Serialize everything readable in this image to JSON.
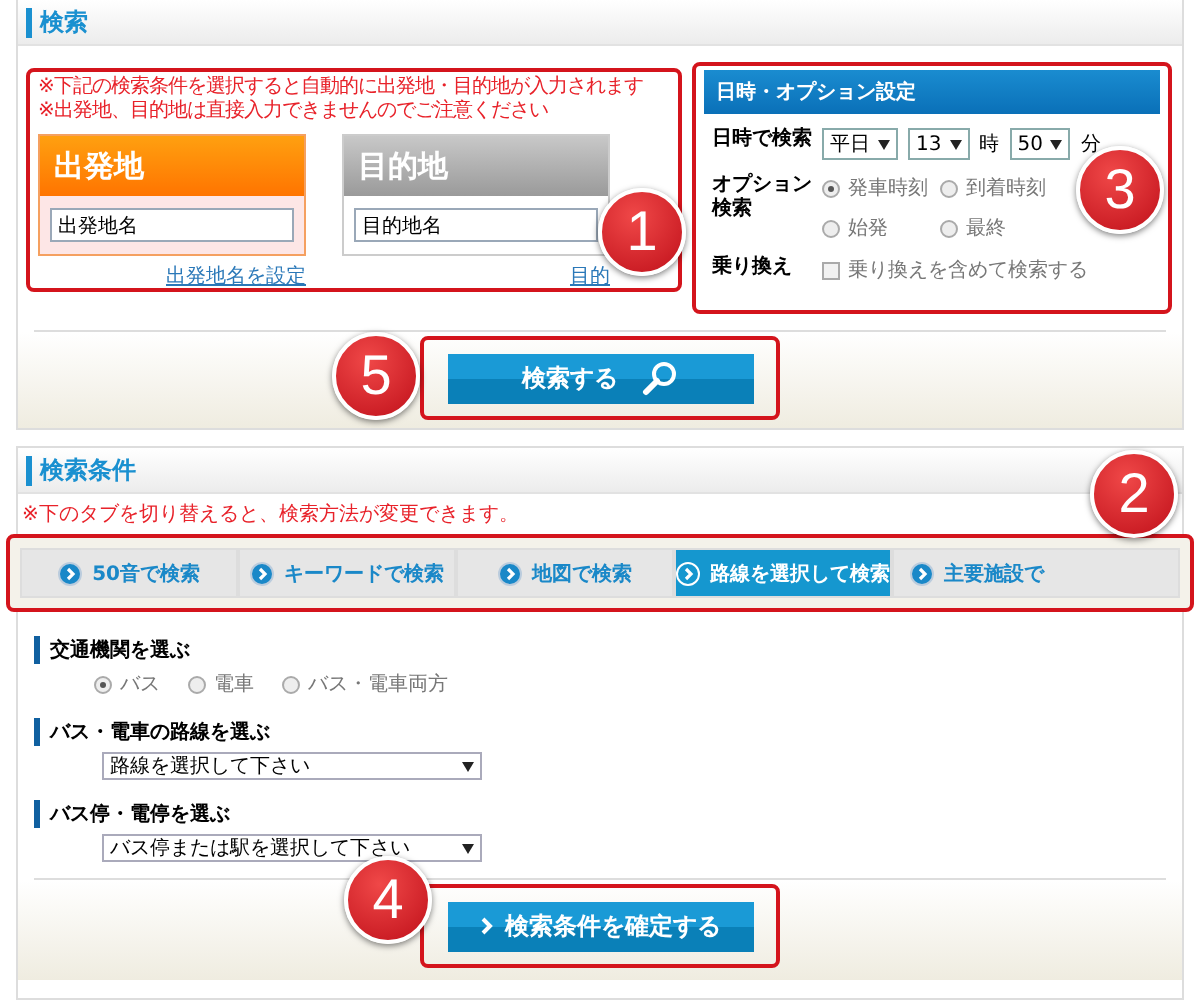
{
  "search_panel": {
    "title": "検索",
    "callout": "1",
    "notices": [
      "※下記の検索条件を選択すると自動的に出発地・目的地が入力されます",
      "※出発地、目的地は直接入力できませんのでご注意ください"
    ],
    "places": [
      {
        "kind": "origin",
        "heading": "出発地",
        "value": "出発地名",
        "link": "出発地名を設定"
      },
      {
        "kind": "destination",
        "heading": "目的地",
        "value": "目的地名",
        "link": "目的"
      }
    ],
    "options": {
      "title": "日時・オプション設定",
      "callout": "3",
      "datetime_label": "日時で検索",
      "day": "平日",
      "hour": "13",
      "hour_unit": "時",
      "minute": "50",
      "minute_unit": "分",
      "option_label": "オプション検索",
      "radios": [
        {
          "label": "発車時刻",
          "selected": true
        },
        {
          "label": "到着時刻",
          "selected": false
        },
        {
          "label": "始発",
          "selected": false
        },
        {
          "label": "最終",
          "selected": false
        }
      ],
      "transfer_label": "乗り換え",
      "transfer": {
        "label": "乗り換えを含めて検索する",
        "checked": false
      }
    },
    "search_button": {
      "label": "検索する",
      "callout": "5"
    }
  },
  "conditions_panel": {
    "title": "検索条件",
    "notice": "※下のタブを切り替えると、検索方法が変更できます。",
    "callout": "2",
    "tabs": [
      {
        "label": "50音で検索",
        "selected": false
      },
      {
        "label": "キーワードで検索",
        "selected": false
      },
      {
        "label": "地図で検索",
        "selected": false
      },
      {
        "label": "路線を選択して検索",
        "selected": true
      },
      {
        "label": "主要施設で",
        "selected": false
      }
    ],
    "groups": [
      {
        "kind": "radios",
        "label": "交通機関を選ぶ",
        "options": [
          {
            "label": "バス",
            "selected": true
          },
          {
            "label": "電車",
            "selected": false
          },
          {
            "label": "バス・電車両方",
            "selected": false
          }
        ]
      },
      {
        "kind": "select",
        "label": "バス・電車の路線を選ぶ",
        "value": "路線を選択して下さい"
      },
      {
        "kind": "select",
        "label": "バス停・電停を選ぶ",
        "value": "バス停または駅を選択して下さい"
      }
    ],
    "confirm_button": {
      "label": "検索条件を確定する",
      "callout": "4"
    }
  }
}
